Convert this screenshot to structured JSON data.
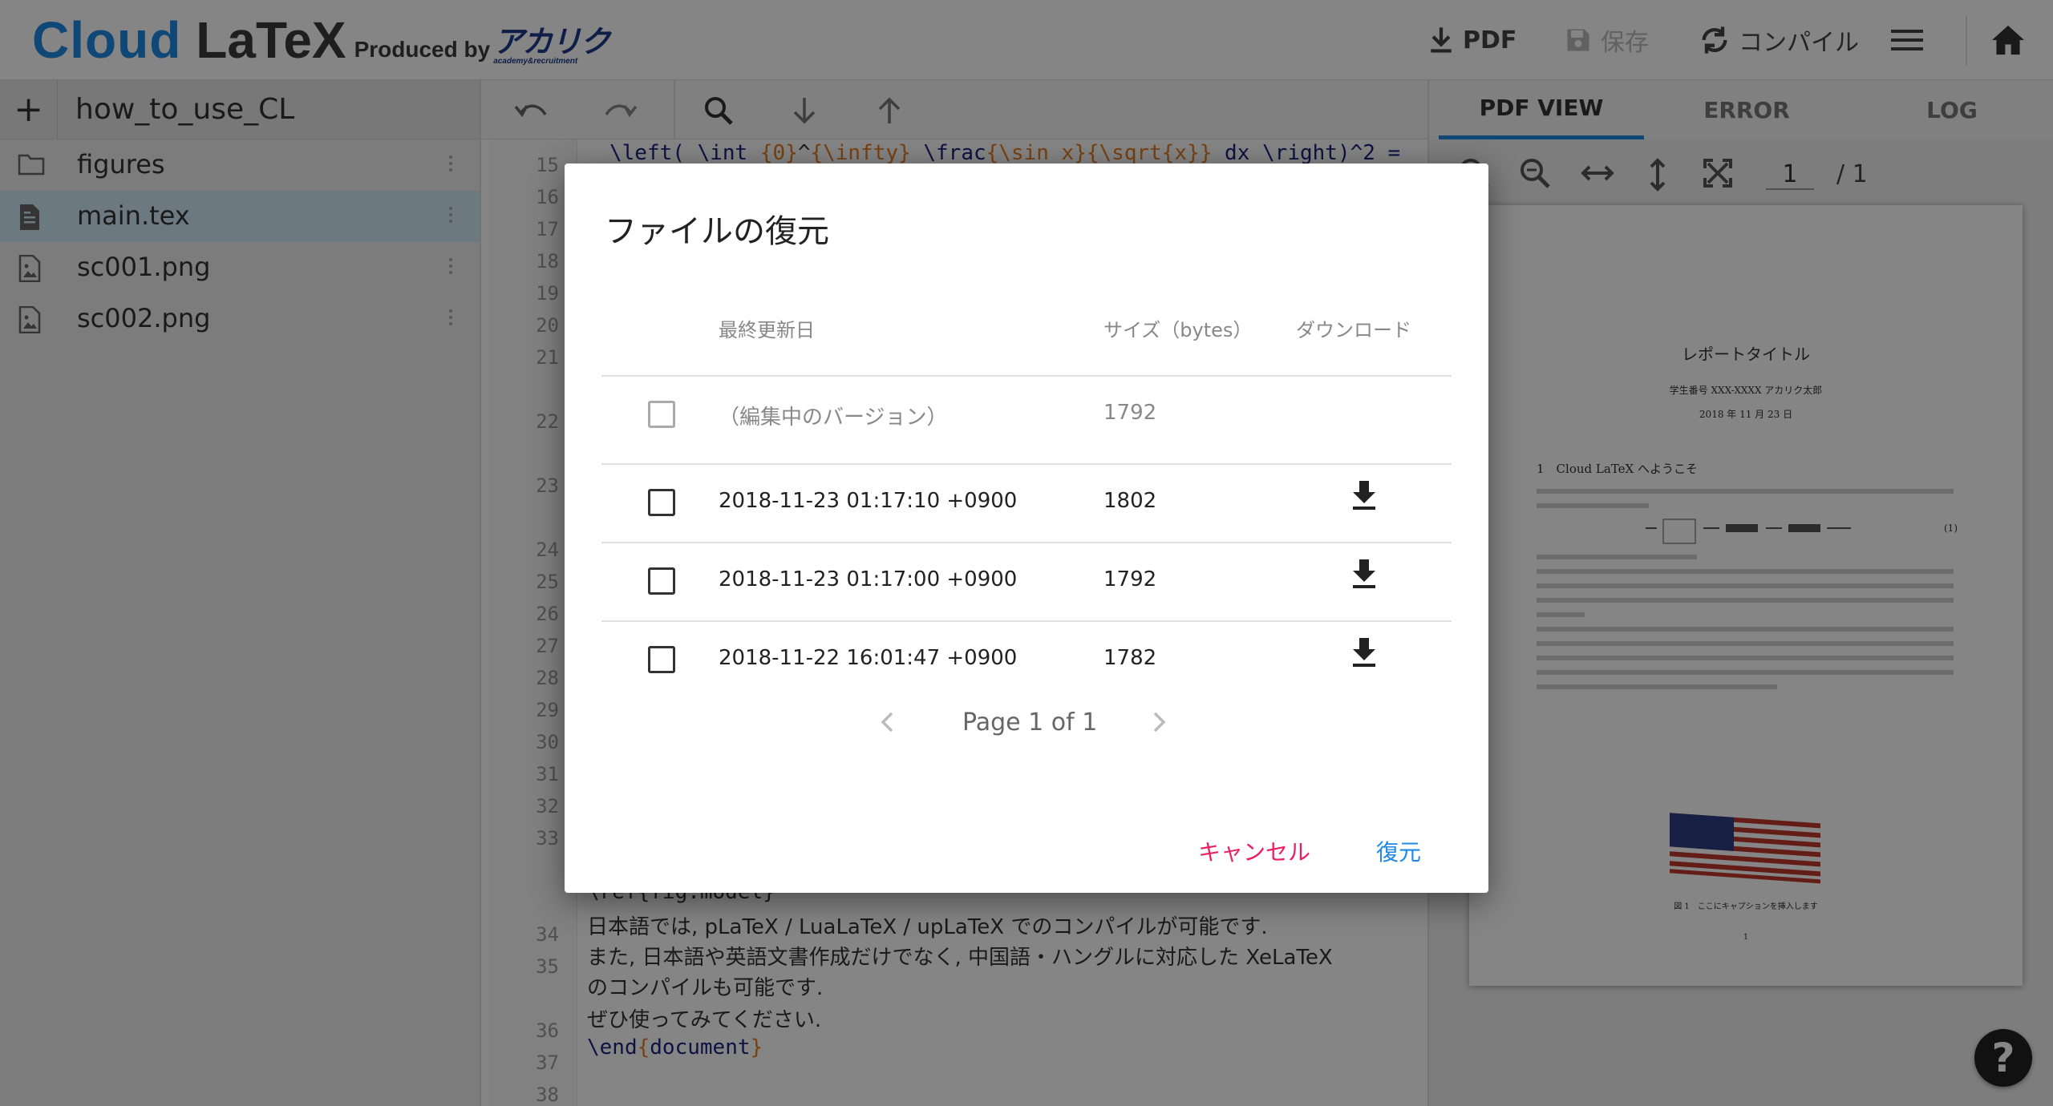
{
  "header": {
    "logo_cloud": "Cloud",
    "logo_latex": "LaTeX",
    "produced_by": "Produced by",
    "brand_akariku": "アカリク",
    "brand_sub": "academy&recruitment",
    "pdf_label": "PDF",
    "save_label": "保存",
    "compile_label": "コンパイル"
  },
  "file_panel": {
    "add_label": "+",
    "project_name": "how_to_use_CL",
    "files": [
      {
        "name": "figures",
        "icon": "folder-icon"
      },
      {
        "name": "main.tex",
        "icon": "document-icon",
        "active": true
      },
      {
        "name": "sc001.png",
        "icon": "image-icon"
      },
      {
        "name": "sc002.png",
        "icon": "image-icon"
      }
    ]
  },
  "editor": {
    "line_numbers": [
      "15",
      "16",
      "17",
      "18",
      "19",
      "20",
      "21",
      "22",
      "23",
      "24",
      "25",
      "26",
      "27",
      "28",
      "29",
      "30",
      "31",
      "32",
      "33",
      "34",
      "35",
      "36",
      "37",
      "38"
    ],
    "line15_a": "\\left( \\int_",
    "line15_b": "{0}",
    "line15_c": "^",
    "line15_d": "{\\infty}",
    "line15_e": " \\frac",
    "line15_f": "{\\sin x}",
    "line15_g": "{\\sqrt",
    "line15_h": "{x}",
    "line15_i": "}",
    "line15_j": " dx \\right)^2 =",
    "line_fragment": "\\ref{fig:model}",
    "line34": "日本語では, pLaTeX / LuaLaTeX / upLaTeX でのコンパイルが可能です.",
    "line35a": "また, 日本語や英語文書作成だけでなく, 中国語・ハングルに対応した XeLaTeX",
    "line35b": "のコンパイルも可能です.",
    "line36": "ぜひ使ってみてください.",
    "line37_cmd": "\\end",
    "line37_open": "{",
    "line37_arg": "document",
    "line37_close": "}"
  },
  "pdf_panel": {
    "tabs": [
      "PDF VIEW",
      "ERROR",
      "LOG"
    ],
    "page_current": "1",
    "page_total": "/ 1",
    "preview": {
      "title": "レポートタイトル",
      "author": "学生番号 XXX-XXXX アカリク太郎",
      "date": "2018 年 11 月 23 日",
      "section": "1　Cloud LaTeX へようこそ",
      "equation_no": "(1)",
      "caption": "図 1　ここにキャプションを挿入します",
      "page_no": "1"
    }
  },
  "dialog": {
    "title": "ファイルの復元",
    "headers": {
      "date": "最終更新日",
      "size": "サイズ（bytes）",
      "download": "ダウンロード"
    },
    "rows": [
      {
        "date": "（編集中のバージョン）",
        "size": "1792",
        "downloadable": false
      },
      {
        "date": "2018-11-23 01:17:10 +0900",
        "size": "1802",
        "downloadable": true
      },
      {
        "date": "2018-11-23 01:17:00 +0900",
        "size": "1792",
        "downloadable": true
      },
      {
        "date": "2018-11-22 16:01:47 +0900",
        "size": "1782",
        "downloadable": true
      }
    ],
    "page_info": "Page 1 of 1",
    "cancel_label": "キャンセル",
    "restore_label": "復元"
  },
  "help_label": "?",
  "colors": {
    "brand_blue": "#1e88e5",
    "cancel_pink": "#e91e63",
    "active_file_bg": "#cfe8f7"
  }
}
